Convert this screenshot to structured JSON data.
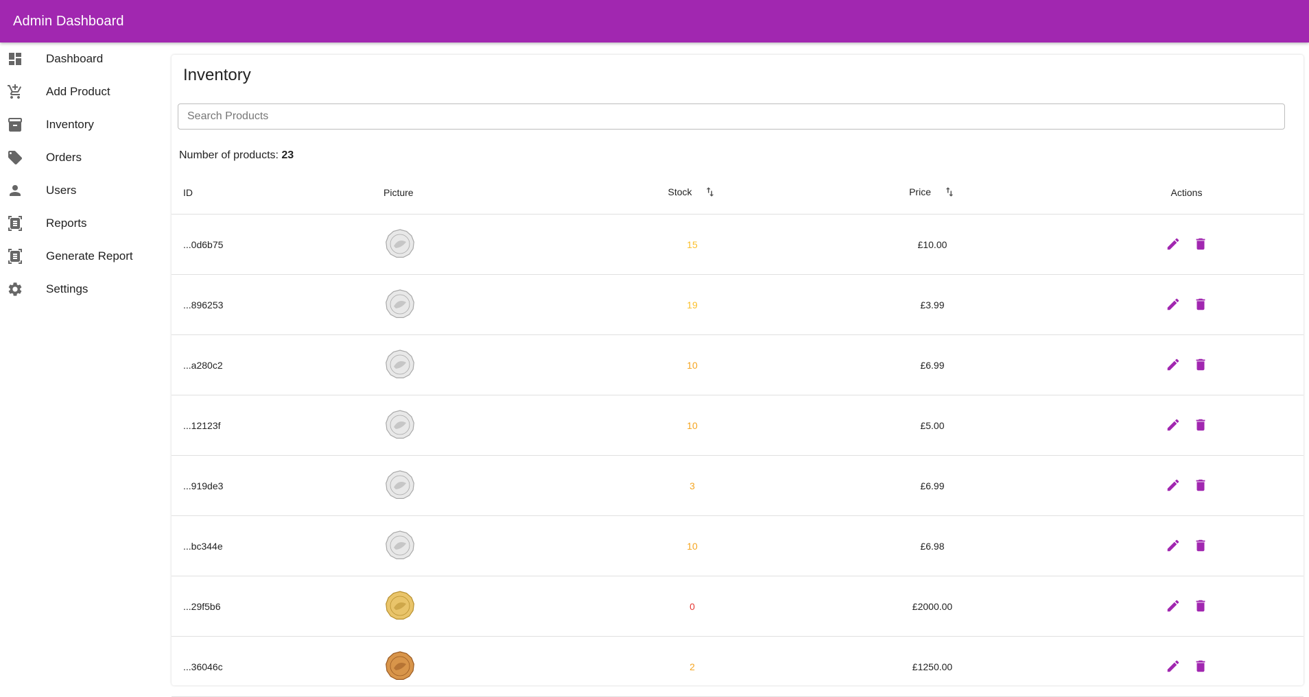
{
  "app": {
    "title": "Admin Dashboard",
    "accent": "#a127b0"
  },
  "sidebar": {
    "items": [
      {
        "label": "Dashboard",
        "icon": "dashboard-icon"
      },
      {
        "label": "Add Product",
        "icon": "add-cart-icon"
      },
      {
        "label": "Inventory",
        "icon": "archive-icon"
      },
      {
        "label": "Orders",
        "icon": "tag-icon"
      },
      {
        "label": "Users",
        "icon": "person-icon"
      },
      {
        "label": "Reports",
        "icon": "document-scan-icon"
      },
      {
        "label": "Generate Report",
        "icon": "document-scan-icon"
      },
      {
        "label": "Settings",
        "icon": "gear-icon"
      }
    ]
  },
  "main": {
    "title": "Inventory",
    "search_placeholder": "Search Products",
    "count_label": "Number of products:",
    "count_value": "23"
  },
  "table": {
    "headers": {
      "id": "ID",
      "picture": "Picture",
      "stock": "Stock",
      "price": "Price",
      "actions": "Actions"
    },
    "rows": [
      {
        "id": "...0d6b75",
        "stock": "15",
        "stock_color": "#fbc02d",
        "price": "£10.00",
        "coin": "silver"
      },
      {
        "id": "...896253",
        "stock": "19",
        "stock_color": "#fbc02d",
        "price": "£3.99",
        "coin": "silver"
      },
      {
        "id": "...a280c2",
        "stock": "10",
        "stock_color": "#f5a623",
        "price": "£6.99",
        "coin": "silver"
      },
      {
        "id": "...12123f",
        "stock": "10",
        "stock_color": "#f5a623",
        "price": "£5.00",
        "coin": "silver"
      },
      {
        "id": "...919de3",
        "stock": "3",
        "stock_color": "#f5a623",
        "price": "£6.99",
        "coin": "silver"
      },
      {
        "id": "...bc344e",
        "stock": "10",
        "stock_color": "#f5a623",
        "price": "£6.98",
        "coin": "silver"
      },
      {
        "id": "...29f5b6",
        "stock": "0",
        "stock_color": "#e53935",
        "price": "£2000.00",
        "coin": "gold"
      },
      {
        "id": "...36046c",
        "stock": "2",
        "stock_color": "#f5a623",
        "price": "£1250.00",
        "coin": "bronze"
      }
    ]
  }
}
